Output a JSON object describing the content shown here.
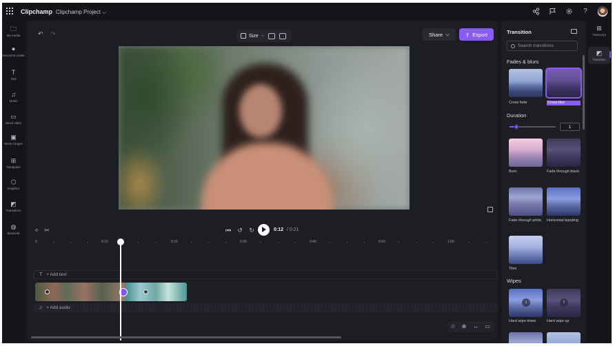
{
  "app": {
    "title": "Clipchamp",
    "project": "Clipchamp Project",
    "project_chevron": "⌵"
  },
  "top_icons": [
    "share-network-icon",
    "flag-icon",
    "settings-icon",
    "help-icon"
  ],
  "left_rail": [
    {
      "label": "My media",
      "icon": "folder-icon",
      "glyph": "🗀"
    },
    {
      "label": "Record & create",
      "icon": "camera-icon",
      "glyph": "⏺"
    },
    {
      "label": "Text",
      "icon": "text-icon",
      "glyph": "T"
    },
    {
      "label": "Music",
      "icon": "music-icon",
      "glyph": "♫"
    },
    {
      "label": "Stock video",
      "icon": "stock-video-icon",
      "glyph": "▭"
    },
    {
      "label": "Stock images",
      "icon": "stock-images-icon",
      "glyph": "▣"
    },
    {
      "label": "Templates",
      "icon": "templates-icon",
      "glyph": "⊞"
    },
    {
      "label": "Graphics",
      "icon": "graphics-icon",
      "glyph": "⬡"
    },
    {
      "label": "Transitions",
      "icon": "transitions-icon",
      "glyph": "◩"
    },
    {
      "label": "Brand kit",
      "icon": "brand-kit-icon",
      "glyph": "◍"
    }
  ],
  "toolbar": {
    "size_label": "Size",
    "share_label": "Share",
    "export_label": "Export",
    "share_chevron": "⌵",
    "export_glyph": "⇪"
  },
  "playback": {
    "current": "0:12",
    "total": "/ 0:21"
  },
  "ruler": [
    "0",
    "0:10",
    "0:20",
    "0:30",
    "0:40",
    "0:50",
    "1:00"
  ],
  "tracks": {
    "add_text": "+ Add text",
    "add_audio": "+ Add audio"
  },
  "panel": {
    "title": "Transition",
    "search_placeholder": "Search transitions",
    "section_fades": "Fades & blurs",
    "section_duration": "Duration",
    "duration_value": "1",
    "section_wipes": "Wipes",
    "items": [
      {
        "label": "Cross fade",
        "style": "t-mountain",
        "selected": false
      },
      {
        "label": "Cross blur",
        "style": "t-mountain-dark",
        "selected": true
      },
      {
        "label": "Burn",
        "style": "t-pink",
        "selected": false
      },
      {
        "label": "Fade through black",
        "style": "t-mountain-dark",
        "selected": false
      },
      {
        "label": "Fade through white",
        "style": "t-purple",
        "selected": false
      },
      {
        "label": "Horizontal banding",
        "style": "t-purple",
        "selected": false
      },
      {
        "label": "Tiles",
        "style": "t-tiles",
        "selected": false
      },
      {
        "label": "Hard wipe down",
        "style": "t-blue",
        "selected": false
      },
      {
        "label": "Hard wipe up",
        "style": "t-mountain-dark",
        "selected": false
      }
    ]
  },
  "right_rail": [
    {
      "label": "Transcript",
      "icon": "transcript-icon",
      "glyph": "⊞"
    },
    {
      "label": "Transition",
      "icon": "transition-icon",
      "glyph": "◩"
    }
  ],
  "colors": {
    "accent": "#8a5cf7",
    "background": "#18181f",
    "panel": "#1d1d24"
  }
}
